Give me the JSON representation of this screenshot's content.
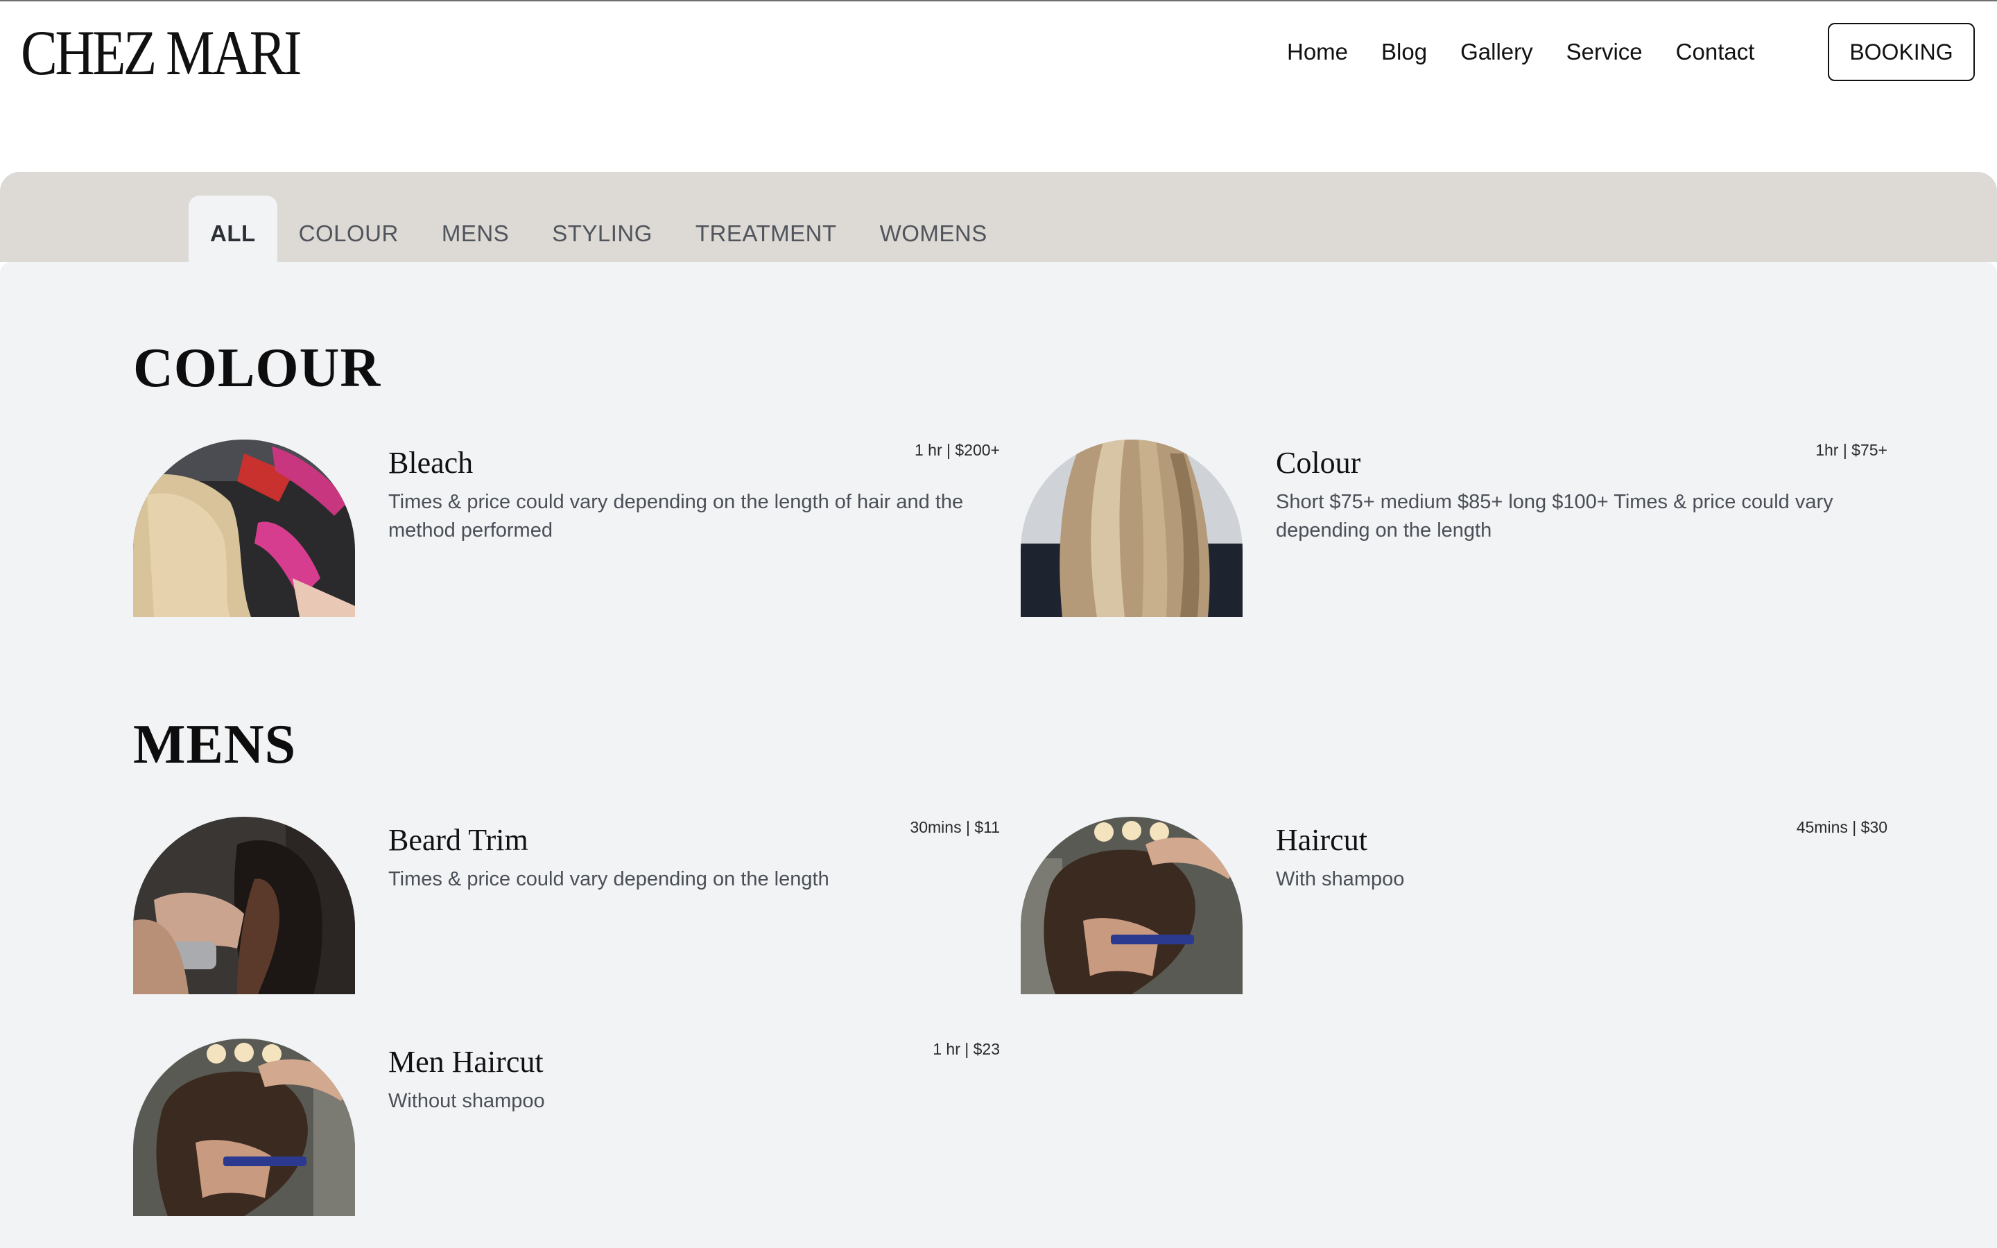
{
  "header": {
    "logo": "CHEZ MARI",
    "nav": [
      "Home",
      "Blog",
      "Gallery",
      "Service",
      "Contact"
    ],
    "booking_label": "BOOKING"
  },
  "tabs": [
    "ALL",
    "COLOUR",
    "MENS",
    "STYLING",
    "TREATMENT",
    "WOMENS"
  ],
  "active_tab": "ALL",
  "sections": [
    {
      "title": "COLOUR",
      "services": [
        {
          "name": "Bleach",
          "meta": "1 hr | $200+",
          "description": "Times & price could vary depending on the length of hair and the method performed",
          "image": "bleach-photo"
        },
        {
          "name": "Colour",
          "meta": "1hr | $75+",
          "description": "Short $75+ medium $85+ long $100+ Times & price could vary depending on the length",
          "image": "colour-photo"
        }
      ]
    },
    {
      "title": "MENS",
      "services": [
        {
          "name": "Beard Trim",
          "meta": "30mins | $11",
          "description": "Times & price could vary depending on the length",
          "image": "beard-trim-photo"
        },
        {
          "name": "Haircut",
          "meta": "45mins | $30",
          "description": "With shampoo",
          "image": "haircut-photo"
        },
        {
          "name": "Men Haircut",
          "meta": "1 hr | $23",
          "description": "Without shampoo",
          "image": "men-haircut-photo"
        }
      ]
    }
  ],
  "colors": {
    "tab_bar": "#ddd9d5",
    "content_bg": "#f2f3f5",
    "text": "#111111",
    "muted_text": "#4a4f57"
  }
}
